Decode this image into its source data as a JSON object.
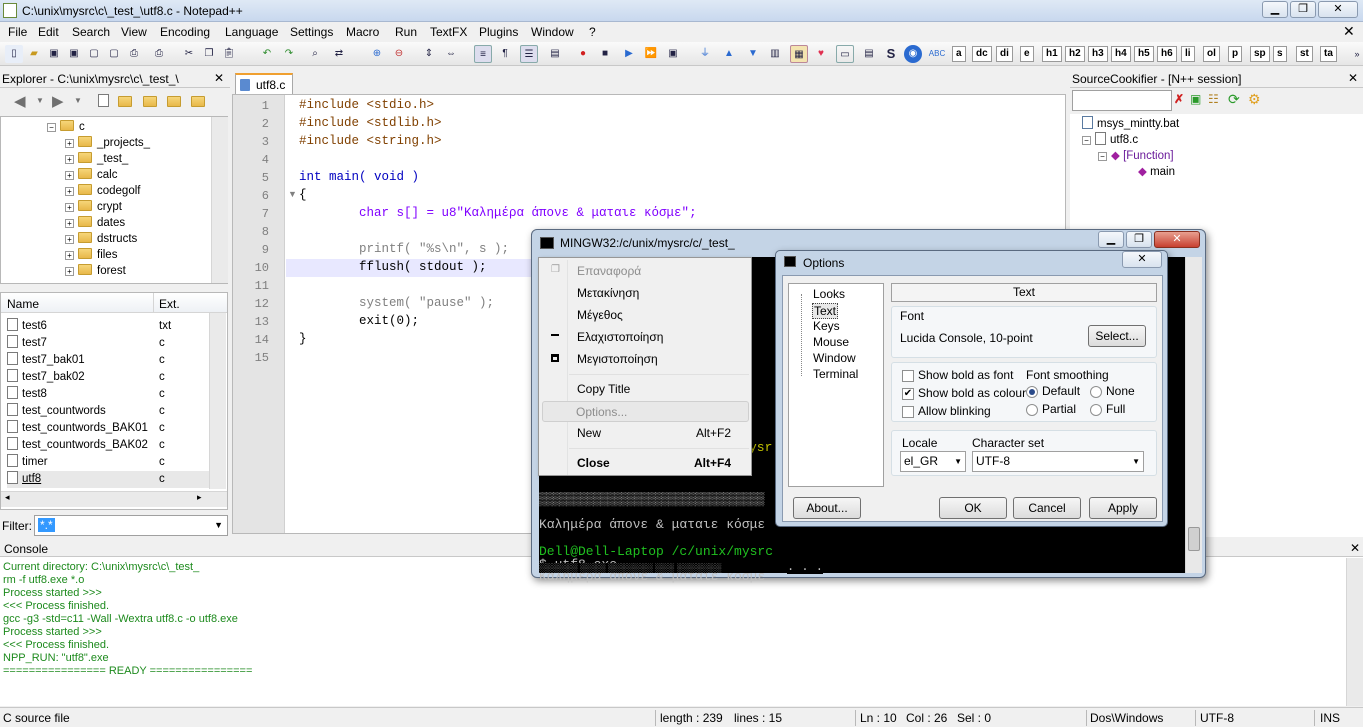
{
  "window": {
    "title": "C:\\unix\\mysrc\\c\\_test_\\utf8.c - Notepad++",
    "min": "▁",
    "max": "❐",
    "close": "✕"
  },
  "menu": [
    "File",
    "Edit",
    "Search",
    "View",
    "Encoding",
    "Language",
    "Settings",
    "Macro",
    "Run",
    "TextFX",
    "Plugins",
    "Window",
    "?"
  ],
  "toolbar_text": [
    "S",
    "a",
    "dc",
    "di",
    "e",
    "h1",
    "h2",
    "h3",
    "h4",
    "h5",
    "h6",
    "li",
    "ol",
    "p",
    "sp",
    "s",
    "st",
    "ta"
  ],
  "explorer": {
    "title": "Explorer - C:\\unix\\mysrc\\c\\_test_\\",
    "tree": [
      "c",
      "_projects_",
      "_test_",
      "calc",
      "codegolf",
      "crypt",
      "dates",
      "dstructs",
      "files",
      "forest"
    ],
    "columns": [
      "Name",
      "Ext."
    ],
    "files": [
      {
        "name": "test6",
        "ext": "txt"
      },
      {
        "name": "test7",
        "ext": "c"
      },
      {
        "name": "test7_bak01",
        "ext": "c"
      },
      {
        "name": "test7_bak02",
        "ext": "c"
      },
      {
        "name": "test8",
        "ext": "c"
      },
      {
        "name": "test_countwords",
        "ext": "c"
      },
      {
        "name": "test_countwords_BAK01",
        "ext": "c"
      },
      {
        "name": "test_countwords_BAK02",
        "ext": "c"
      },
      {
        "name": "timer",
        "ext": "c"
      },
      {
        "name": "utf8",
        "ext": "c"
      }
    ],
    "filter_label": "Filter:",
    "filter_value": "*.*"
  },
  "editor": {
    "tab": "utf8.c",
    "lines": [
      {
        "n": "1",
        "text": "#include <stdio.h>"
      },
      {
        "n": "2",
        "text": "#include <stdlib.h>"
      },
      {
        "n": "3",
        "text": "#include <string.h>"
      },
      {
        "n": "4",
        "text": ""
      },
      {
        "n": "5",
        "text": "int main( void )"
      },
      {
        "n": "6",
        "text": "{"
      },
      {
        "n": "7",
        "text": "        char s[] = u8\"Καλημέρα άπονε & ματαιε κόσμε\";"
      },
      {
        "n": "8",
        "text": ""
      },
      {
        "n": "9",
        "text": "        printf( \"%s\\n\", s );"
      },
      {
        "n": "10",
        "text": "        fflush( stdout );"
      },
      {
        "n": "11",
        "text": ""
      },
      {
        "n": "12",
        "text": "        system( \"pause\" );"
      },
      {
        "n": "13",
        "text": "        exit(0);"
      },
      {
        "n": "14",
        "text": "}"
      },
      {
        "n": "15",
        "text": ""
      }
    ]
  },
  "cookifier": {
    "title": "SourceCookifier - [N++ session]",
    "items": [
      "msys_mintty.bat",
      "utf8.c",
      "[Function]",
      "main"
    ]
  },
  "console": {
    "title": "Console",
    "lines": [
      "Current directory: C:\\unix\\mysrc\\c\\_test_",
      "rm -f utf8.exe *.o",
      "Process started >>>",
      "<<< Process finished.",
      "gcc -g3 -std=c11 -Wall -Wextra utf8.c -o utf8.exe",
      "Process started >>>",
      "<<< Process finished.",
      "NPP_RUN: \"utf8\".exe",
      "================ READY ================"
    ]
  },
  "status": {
    "type": "C source file",
    "length": "length : 239",
    "lines": "lines : 15",
    "ln": "Ln : 10",
    "col": "Col : 26",
    "sel": "Sel : 0",
    "eol": "Dos\\Windows",
    "enc": "UTF-8",
    "mode": "INS"
  },
  "mingw": {
    "title": "MINGW32:/c/unix/mysrc/c/_test_",
    "term": [
      "Καλημέρα άπονε & ματαιε κόσμε",
      "Dell@Dell-Laptop /c/unix/mysrc",
      "$ utf8.exe",
      "Καλημέρα άπονε & ματαιε κόσμε"
    ],
    "partial_yellow": "ysr",
    "pause_tail": ". . . "
  },
  "context_menu": [
    {
      "label": "Επαναφορά",
      "acc": "",
      "disabled": true
    },
    {
      "label": "Μετακίνηση",
      "acc": ""
    },
    {
      "label": "Μέγεθος",
      "acc": ""
    },
    {
      "label": "Ελαχιστοποίηση",
      "acc": ""
    },
    {
      "label": "Μεγιστοποίηση",
      "acc": ""
    },
    {
      "label": "Copy Title",
      "acc": ""
    },
    {
      "label": "Options...",
      "acc": "",
      "disabled": true
    },
    {
      "label": "New",
      "acc": "Alt+F2"
    },
    {
      "label": "Close",
      "acc": "Alt+F4",
      "bold": true
    }
  ],
  "options": {
    "title": "Options",
    "nav": [
      "Looks",
      "Text",
      "Keys",
      "Mouse",
      "Window",
      "Terminal"
    ],
    "section": "Text",
    "font_label": "Font",
    "font_value": "Lucida Console, 10-point",
    "select_btn": "Select...",
    "show_bold_font": "Show bold as font",
    "show_bold_colour": "Show bold as colour",
    "allow_blinking": "Allow blinking",
    "smoothing_label": "Font smoothing",
    "smoothing": [
      "Default",
      "None",
      "Partial",
      "Full"
    ],
    "locale_label": "Locale",
    "locale_value": "el_GR",
    "charset_label": "Character set",
    "charset_value": "UTF-8",
    "about": "About...",
    "ok": "OK",
    "cancel": "Cancel",
    "apply": "Apply"
  }
}
